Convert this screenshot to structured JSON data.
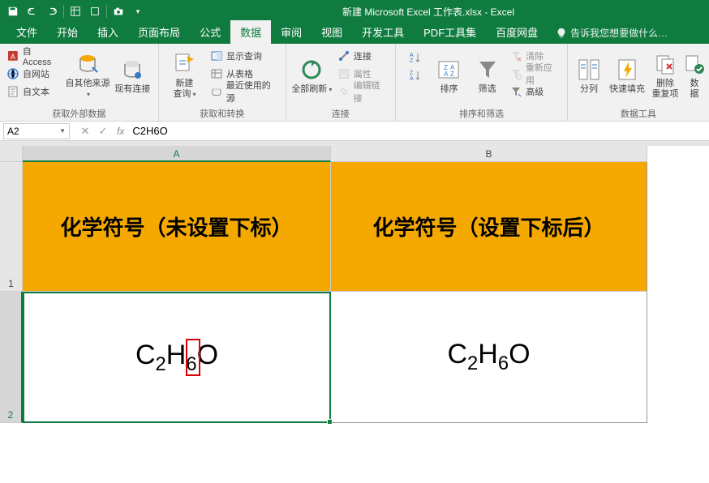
{
  "title": "新建 Microsoft Excel 工作表.xlsx - Excel",
  "tabs": [
    "文件",
    "开始",
    "插入",
    "页面布局",
    "公式",
    "数据",
    "审阅",
    "视图",
    "开发工具",
    "PDF工具集",
    "百度网盘"
  ],
  "active_tab": "数据",
  "tell_me": "告诉我您想要做什么…",
  "ribbon": {
    "g1": {
      "access": "自 Access",
      "web": "自网站",
      "text": "自文本",
      "other": "自其他来源",
      "existing": "现有连接",
      "label": "获取外部数据"
    },
    "g2": {
      "newq": "新建\n查询",
      "show": "显示查询",
      "table": "从表格",
      "recent": "最近使用的源",
      "label": "获取和转换"
    },
    "g3": {
      "refresh": "全部刷新",
      "conn": "连接",
      "prop": "属性",
      "edit": "编辑链接",
      "label": "连接"
    },
    "g4": {
      "sort": "排序",
      "filter": "筛选",
      "clear": "清除",
      "reapply": "重新应用",
      "adv": "高级",
      "label": "排序和筛选"
    },
    "g5": {
      "ttc": "分列",
      "flash": "快速填充",
      "dup": "删除\n重复项",
      "valid": "数\n据",
      "label": "数据工具"
    }
  },
  "namebox": "A2",
  "formula": "C2H6O",
  "grid": {
    "colA": "A",
    "colB": "B",
    "r1": "1",
    "r2": "2",
    "a1": "化学符号（未设置下标）",
    "b1": "化学符号（设置下标后）"
  }
}
